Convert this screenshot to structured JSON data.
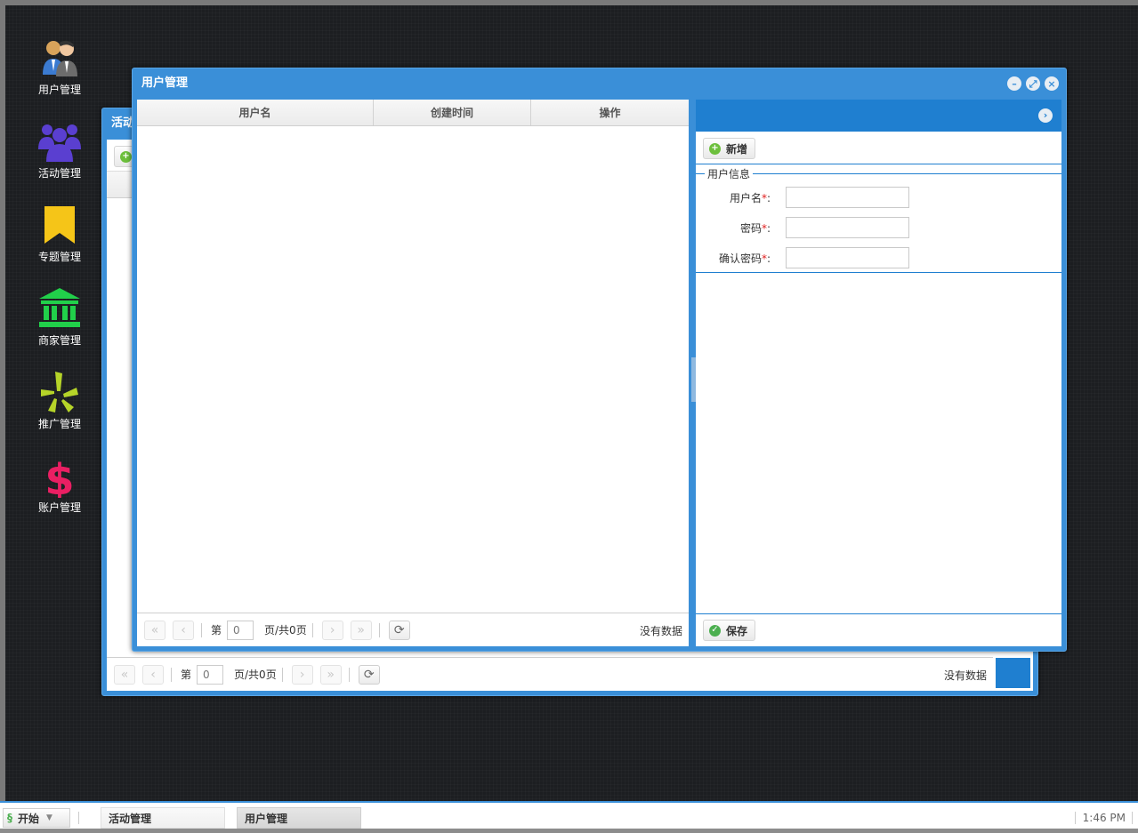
{
  "desktop": {
    "icons": [
      {
        "label": "用户管理",
        "icon": "users-icon",
        "color": "#3b7bd1"
      },
      {
        "label": "活动管理",
        "icon": "group-icon",
        "color": "#5a3fd0"
      },
      {
        "label": "专题管理",
        "icon": "bookmark-icon",
        "color": "#f5c518"
      },
      {
        "label": "商家管理",
        "icon": "bank-icon",
        "color": "#21d04a"
      },
      {
        "label": "推广管理",
        "icon": "yelp-burst-icon",
        "color": "#b6d429"
      },
      {
        "label": "账户管理",
        "icon": "dollar-icon",
        "color": "#ea1f63"
      }
    ]
  },
  "bg_window": {
    "title": "活动",
    "pager": {
      "page_prefix": "第",
      "page_value": "0",
      "page_suffix": "页/共0页",
      "info": "没有数据"
    }
  },
  "user_window": {
    "title": "用户管理",
    "grid": {
      "columns": [
        "用户名",
        "创建时间",
        "操作"
      ],
      "pager": {
        "page_prefix": "第",
        "page_value": "0",
        "page_suffix": "页/共0页",
        "info": "没有数据"
      }
    },
    "side_panel": {
      "add_label": "新增",
      "fieldset_legend": "用户信息",
      "fields": [
        {
          "label": "用户名",
          "value": ""
        },
        {
          "label": "密码",
          "value": ""
        },
        {
          "label": "确认密码",
          "value": ""
        }
      ],
      "save_label": "保存"
    }
  },
  "taskbar": {
    "start_label": "开始",
    "tasks": [
      "活动管理",
      "用户管理"
    ],
    "clock": "1:46 PM"
  },
  "colors": {
    "accent": "#3a8fd8",
    "header_blue": "#1f7fd0",
    "required": "#e02020"
  }
}
